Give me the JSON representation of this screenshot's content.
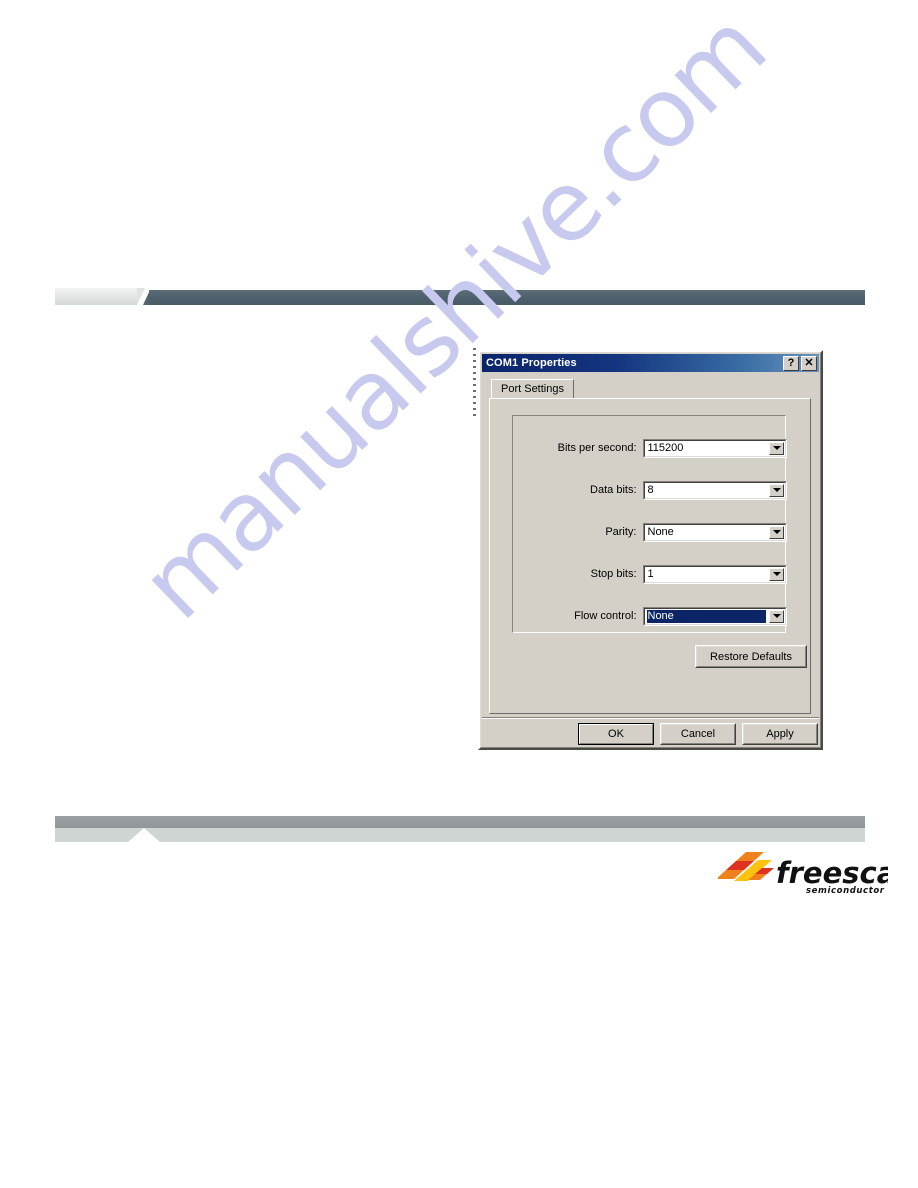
{
  "page": {
    "background_color": "#ffffff",
    "watermark_text": "manualshive.com",
    "watermark_color": "#c8c9ee"
  },
  "slide": {
    "header_rule": {
      "light_color": "#e4e8e6",
      "dark_color": "#4c5f6b"
    },
    "footer_rule": {
      "dark_color": "#949a9e",
      "light_color": "#cfd5d2"
    }
  },
  "brand": {
    "name": "freescale",
    "tagline": "semiconductor",
    "colors": {
      "wordmark": "#111111",
      "orange": "#f0821e",
      "red": "#e0301e",
      "yellow": "#ffc20e"
    }
  },
  "dialog": {
    "title": "COM1 Properties",
    "titlebar_buttons": [
      {
        "name": "help-button",
        "glyph": "?"
      },
      {
        "name": "close-button",
        "glyph": "✕"
      }
    ],
    "tabs": [
      {
        "label": "Port Settings",
        "active": true
      }
    ],
    "fields": [
      {
        "label": "Bits per second:",
        "value": "115200",
        "selected": false
      },
      {
        "label": "Data bits:",
        "value": "8",
        "selected": false
      },
      {
        "label": "Parity:",
        "value": "None",
        "selected": false
      },
      {
        "label": "Stop bits:",
        "value": "1",
        "selected": false
      },
      {
        "label": "Flow control:",
        "value": "None",
        "selected": true
      }
    ],
    "restore_defaults_label": "Restore Defaults",
    "buttons": {
      "ok": "OK",
      "cancel": "Cancel",
      "apply": "Apply"
    },
    "colors": {
      "face": "#d4d0c8",
      "titlebar_start": "#0a246a",
      "titlebar_end": "#6a93bd",
      "selection": "#0b2567"
    }
  }
}
